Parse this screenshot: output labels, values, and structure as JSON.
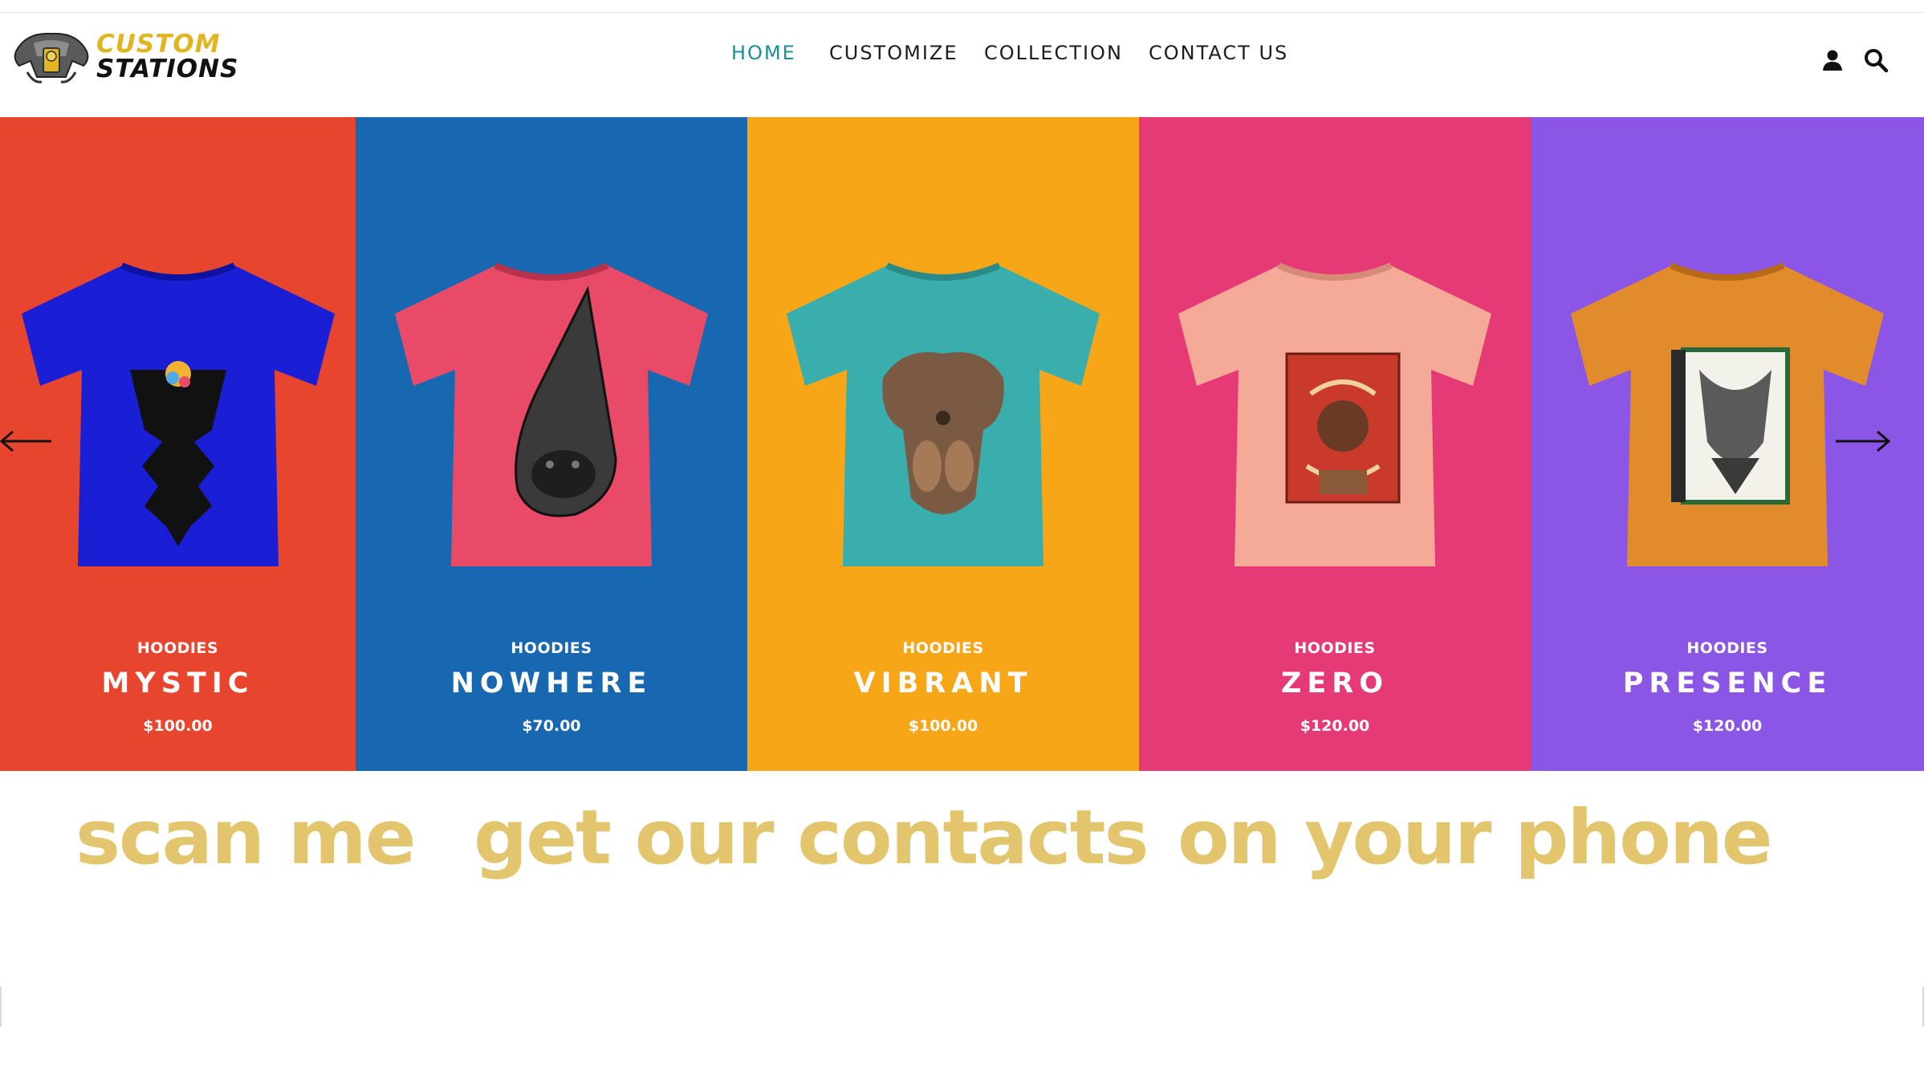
{
  "brand": {
    "line1": "CUSTOM",
    "line2": "STATIONS",
    "accent_color": "#e0b520"
  },
  "nav": {
    "items": [
      {
        "label": "HOME",
        "active": true
      },
      {
        "label": "CUSTOMIZE",
        "active": false
      },
      {
        "label": "COLLECTION",
        "active": false
      },
      {
        "label": "CONTACT US",
        "active": false
      }
    ],
    "active_color": "#1a8f95",
    "icons": [
      "user-icon",
      "search-icon"
    ]
  },
  "carousel": {
    "products": [
      {
        "category": "HOODIES",
        "name": "MYSTIC",
        "price": "$100.00",
        "background": "#e8452f",
        "shirt_color": "#1a1fd6"
      },
      {
        "category": "HOODIES",
        "name": "NOWHERE",
        "price": "$70.00",
        "background": "#1768b0",
        "shirt_color": "#e84a68"
      },
      {
        "category": "HOODIES",
        "name": "VIBRANT",
        "price": "$100.00",
        "background": "#f7a617",
        "shirt_color": "#3aaeac"
      },
      {
        "category": "HOODIES",
        "name": "ZERO",
        "price": "$120.00",
        "background": "#e63a76",
        "shirt_color": "#f4aa97"
      },
      {
        "category": "HOODIES",
        "name": "PRESENCE",
        "price": "$120.00",
        "background": "#8b55e6",
        "shirt_color": "#e28b2c"
      }
    ],
    "controls": [
      "arrow-left-icon",
      "arrow-right-icon"
    ]
  },
  "slogan": {
    "part1": "scan me",
    "part2": "get our contacts",
    "part3": "on your phone",
    "color": "#e2c56c"
  }
}
